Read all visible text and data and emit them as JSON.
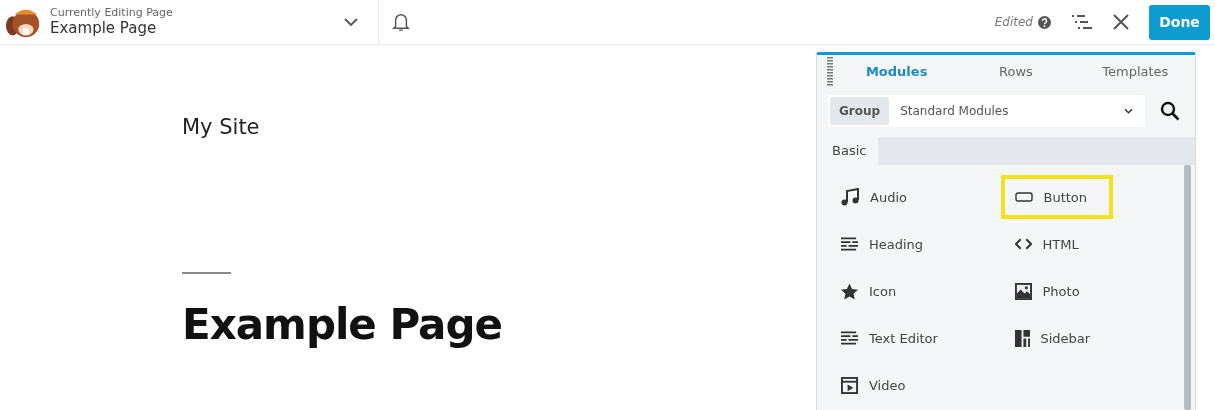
{
  "header": {
    "caption": "Currently Editing Page",
    "page_title": "Example Page",
    "status": "Edited",
    "done_button": "Done"
  },
  "page": {
    "site_title": "My Site",
    "heading": "Example Page"
  },
  "panel": {
    "tabs": [
      {
        "label": "Modules",
        "selected": true
      },
      {
        "label": "Rows",
        "selected": false
      },
      {
        "label": "Templates",
        "selected": false
      }
    ],
    "group_label": "Group",
    "group_value": "Standard Modules",
    "section": "Basic",
    "modules": [
      {
        "label": "Audio",
        "kind": "audio",
        "highlighted": false
      },
      {
        "label": "Button",
        "kind": "button",
        "highlighted": true
      },
      {
        "label": "Heading",
        "kind": "heading",
        "highlighted": false
      },
      {
        "label": "HTML",
        "kind": "html",
        "highlighted": false
      },
      {
        "label": "Icon",
        "kind": "icon",
        "highlighted": false
      },
      {
        "label": "Photo",
        "kind": "photo",
        "highlighted": false
      },
      {
        "label": "Text Editor",
        "kind": "text",
        "highlighted": false
      },
      {
        "label": "Sidebar",
        "kind": "sidebar",
        "highlighted": false
      },
      {
        "label": "Video",
        "kind": "video",
        "highlighted": false
      }
    ]
  }
}
